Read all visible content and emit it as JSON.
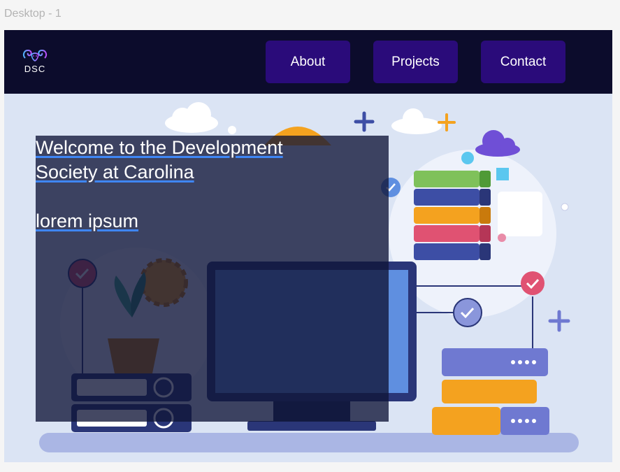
{
  "frame": {
    "label": "Desktop - 1"
  },
  "nav": {
    "logo_text": "DSC",
    "buttons": [
      {
        "label": "About"
      },
      {
        "label": "Projects"
      },
      {
        "label": "Contact"
      }
    ]
  },
  "hero": {
    "title": "Welcome to the Development Society at Carolina",
    "subtitle": "lorem ipsum"
  },
  "colors": {
    "nav_background": "#0c0c2c",
    "nav_button": "#2a0b7a",
    "hero_background": "#dbe4f4",
    "underline_accent": "#3f86f5"
  }
}
